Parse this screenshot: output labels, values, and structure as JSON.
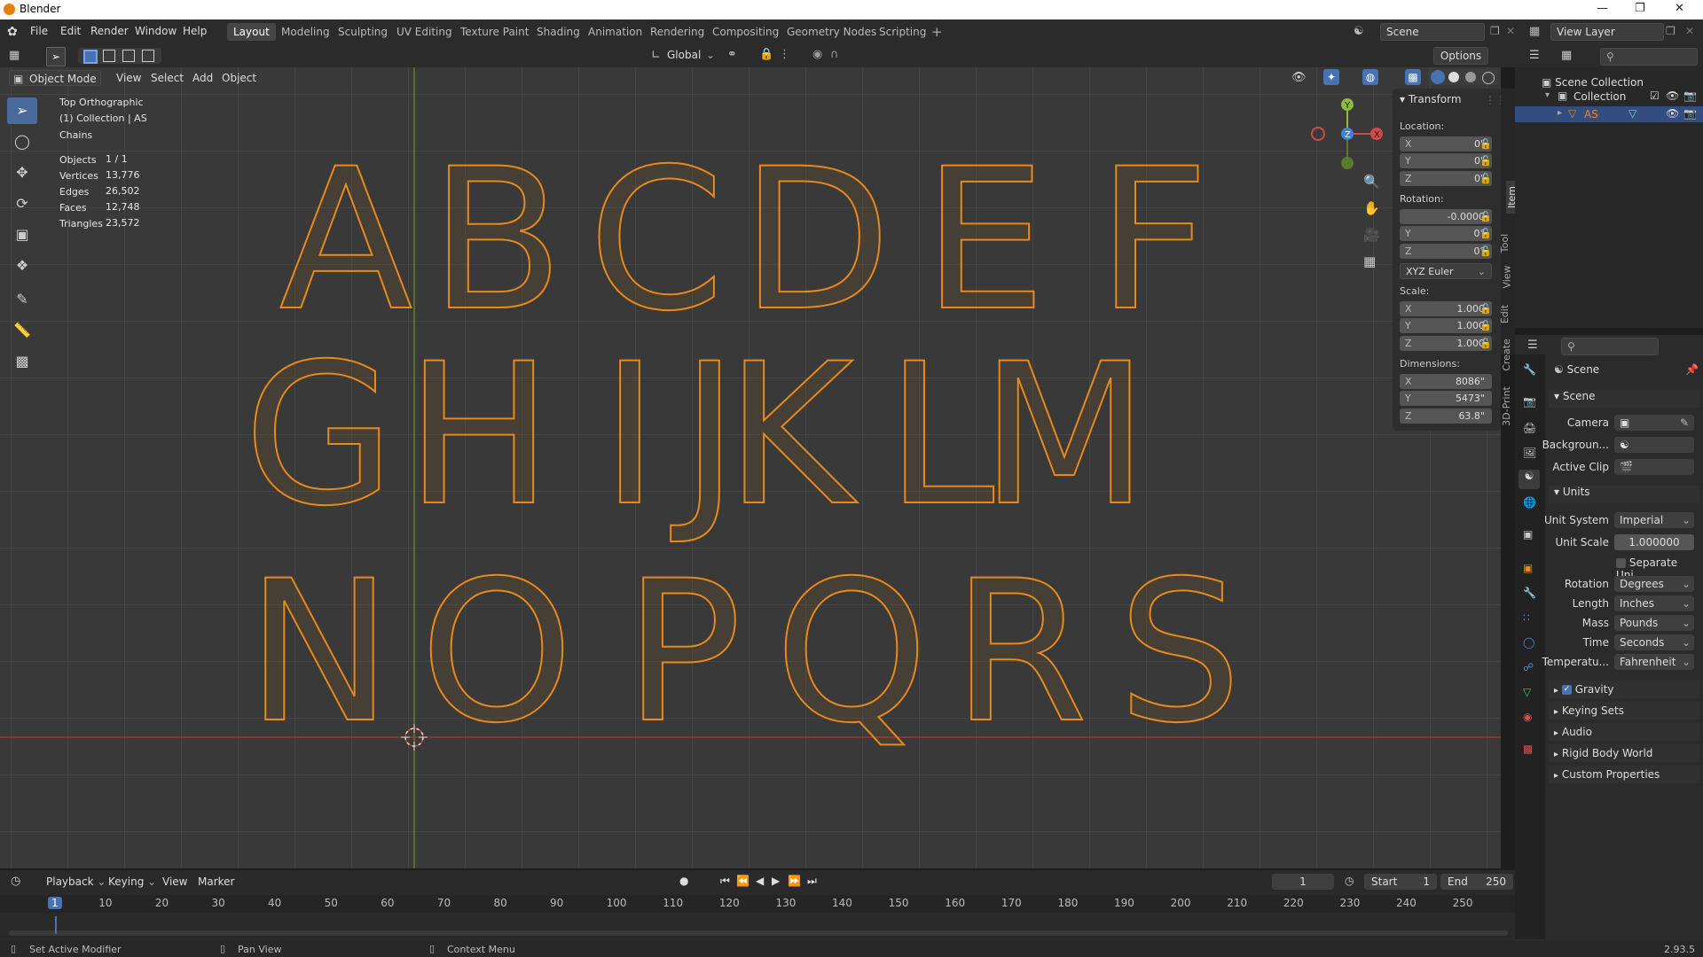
{
  "window": {
    "title": "Blender"
  },
  "menu": [
    "File",
    "Edit",
    "Render",
    "Window",
    "Help"
  ],
  "workspaces": [
    "Layout",
    "Modeling",
    "Sculpting",
    "UV Editing",
    "Texture Paint",
    "Shading",
    "Animation",
    "Rendering",
    "Compositing",
    "Geometry Nodes",
    "Scripting"
  ],
  "active_workspace": "Layout",
  "scene_name": "Scene",
  "view_layer": "View Layer",
  "header": {
    "transform_orientation": "Global",
    "options": "Options"
  },
  "viewport_header": {
    "mode": "Object Mode",
    "items": [
      "View",
      "Select",
      "Add",
      "Object"
    ]
  },
  "viewport_info": {
    "view": "Top Orthographic",
    "collection": "(1) Collection | AS",
    "object": "Chains",
    "stats": [
      {
        "label": "Objects",
        "value": "1 / 1"
      },
      {
        "label": "Vertices",
        "value": "13,776"
      },
      {
        "label": "Edges",
        "value": "26,502"
      },
      {
        "label": "Faces",
        "value": "12,748"
      },
      {
        "label": "Triangles",
        "value": "23,572"
      }
    ]
  },
  "letters": [
    "A",
    "B",
    "C",
    "D",
    "E",
    "F",
    "G",
    "H",
    "I",
    "J",
    "K",
    "L",
    "M",
    "N",
    "O",
    "P",
    "Q",
    "R",
    "S"
  ],
  "npanel": {
    "section": "Transform",
    "location_label": "Location:",
    "location": [
      {
        "axis": "X",
        "value": "0\""
      },
      {
        "axis": "Y",
        "value": "0\""
      },
      {
        "axis": "Z",
        "value": "0\""
      }
    ],
    "rotation_label": "Rotation:",
    "rotation": [
      {
        "axis": "",
        "value": "-0.0000"
      },
      {
        "axis": "Y",
        "value": "0°"
      },
      {
        "axis": "Z",
        "value": "0°"
      }
    ],
    "rotation_mode": "XYZ Euler",
    "scale_label": "Scale:",
    "scale": [
      {
        "axis": "X",
        "value": "1.000"
      },
      {
        "axis": "Y",
        "value": "1.000"
      },
      {
        "axis": "Z",
        "value": "1.000"
      }
    ],
    "dimensions_label": "Dimensions:",
    "dimensions": [
      {
        "axis": "X",
        "value": "8086\""
      },
      {
        "axis": "Y",
        "value": "5473\""
      },
      {
        "axis": "Z",
        "value": "63.8\""
      }
    ],
    "tabs": [
      "Item",
      "Tool",
      "View",
      "Edit",
      "Create",
      "3D-Print"
    ]
  },
  "outliner": {
    "root": "Scene Collection",
    "collection": "Collection",
    "object": "AS"
  },
  "properties": {
    "context": "Scene",
    "scene_panel": "Scene",
    "camera_label": "Camera",
    "background_label": "Backgroun...",
    "active_clip_label": "Active Clip",
    "units_panel": "Units",
    "unit_system_label": "Unit System",
    "unit_system": "Imperial",
    "unit_scale_label": "Unit Scale",
    "unit_scale": "1.000000",
    "separate_units": "Separate Uni...",
    "rotation_label": "Rotation",
    "rotation": "Degrees",
    "length_label": "Length",
    "length": "Inches",
    "mass_label": "Mass",
    "mass": "Pounds",
    "time_label": "Time",
    "time": "Seconds",
    "temperature_label": "Temperatu...",
    "temperature": "Fahrenheit",
    "collapsed": [
      "Gravity",
      "Keying Sets",
      "Audio",
      "Rigid Body World",
      "Custom Properties"
    ]
  },
  "timeline": {
    "menus": [
      "Playback",
      "Keying",
      "View",
      "Marker"
    ],
    "current_frame": "1",
    "start_label": "Start",
    "start": "1",
    "end_label": "End",
    "end": "250",
    "ticks": [
      "1",
      "10",
      "20",
      "30",
      "40",
      "50",
      "60",
      "70",
      "80",
      "90",
      "100",
      "110",
      "120",
      "130",
      "140",
      "150",
      "160",
      "170",
      "180",
      "190",
      "200",
      "210",
      "220",
      "230",
      "240",
      "250"
    ]
  },
  "statusbar": {
    "left": "Set Active Modifier",
    "middle": "Pan View",
    "right": "Context Menu",
    "version": "2.93.5"
  },
  "colors": {
    "accent": "#4772b3",
    "wire": "#e8891c",
    "selected_text": "#e8891c"
  }
}
